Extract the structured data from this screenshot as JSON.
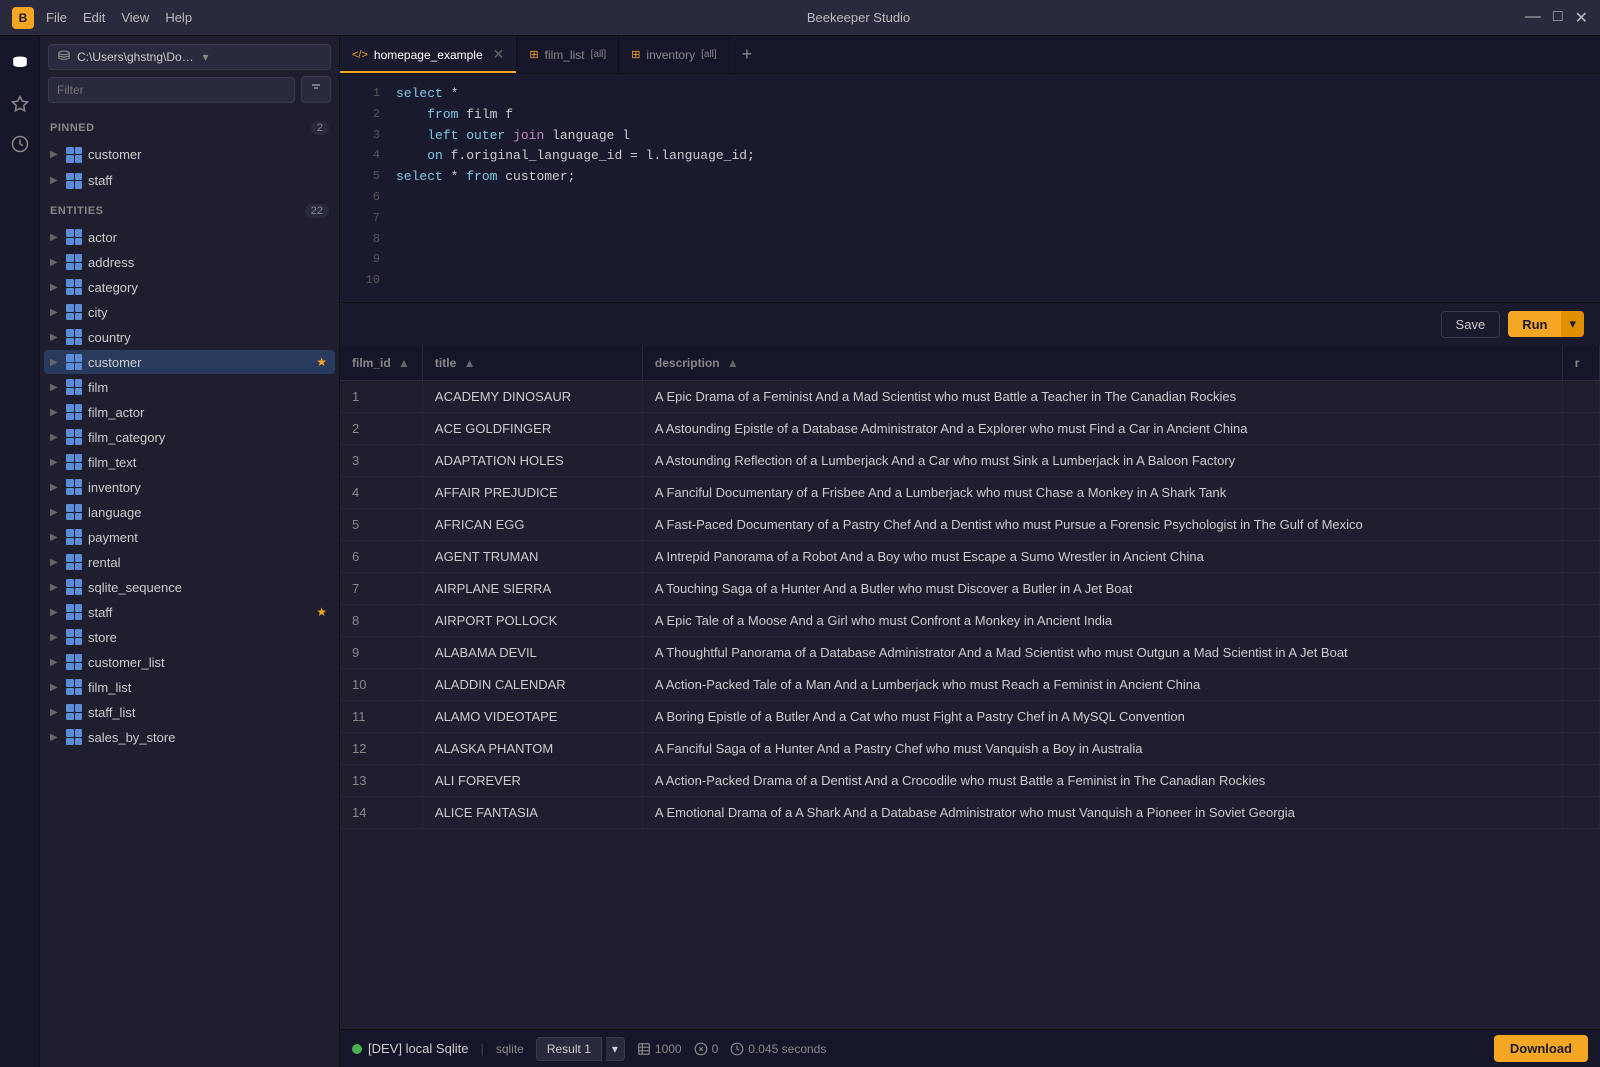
{
  "app": {
    "title": "Beekeeper Studio",
    "icon": "B"
  },
  "titlebar": {
    "menus": [
      "File",
      "Edit",
      "View",
      "Help"
    ],
    "min": "—",
    "max": "□",
    "close": "✕"
  },
  "sidebar": {
    "db_path": "C:\\Users\\ghstng\\Downloads",
    "filter_placeholder": "Filter",
    "pinned": {
      "label": "PINNED",
      "count": 2,
      "items": [
        {
          "name": "customer",
          "pinned": false,
          "removable": true
        },
        {
          "name": "staff",
          "pinned": false,
          "removable": true
        }
      ]
    },
    "entities": {
      "label": "ENTITIES",
      "count": 22,
      "items": [
        "actor",
        "address",
        "category",
        "city",
        "country",
        "customer",
        "film",
        "film_actor",
        "film_category",
        "film_text",
        "inventory",
        "language",
        "payment",
        "rental",
        "sqlite_sequence",
        "staff",
        "store",
        "customer_list",
        "film_list",
        "staff_list",
        "sales_by_store"
      ],
      "starred": [
        "customer",
        "staff"
      ]
    }
  },
  "tabs": [
    {
      "label": "homepage_example",
      "type": "query",
      "active": true,
      "closable": true
    },
    {
      "label": "film_list",
      "badge": "[all]",
      "type": "table",
      "active": false,
      "closable": false
    },
    {
      "label": "inventory",
      "badge": "[all]",
      "type": "table",
      "active": false,
      "closable": false
    }
  ],
  "editor": {
    "lines": [
      {
        "num": 1,
        "tokens": [
          {
            "t": "kw",
            "v": "select"
          },
          {
            "t": "op",
            "v": " *"
          }
        ]
      },
      {
        "num": 2,
        "tokens": [
          {
            "t": "kw",
            "v": "  from"
          },
          {
            "t": "op",
            "v": " film f"
          }
        ]
      },
      {
        "num": 3,
        "tokens": [
          {
            "t": "kw",
            "v": "  left outer"
          },
          {
            "t": "kw2",
            "v": " join"
          },
          {
            "t": "op",
            "v": " language l"
          }
        ]
      },
      {
        "num": 4,
        "tokens": [
          {
            "t": "kw",
            "v": "  on"
          },
          {
            "t": "op",
            "v": " f.original_language_id = l.language_id;"
          }
        ]
      },
      {
        "num": 5,
        "tokens": [
          {
            "t": "kw",
            "v": "select"
          },
          {
            "t": "op",
            "v": " * "
          },
          {
            "t": "kw",
            "v": "from"
          },
          {
            "t": "op",
            "v": " customer;"
          }
        ]
      },
      {
        "num": 6,
        "tokens": []
      },
      {
        "num": 7,
        "tokens": []
      },
      {
        "num": 8,
        "tokens": []
      },
      {
        "num": 9,
        "tokens": []
      },
      {
        "num": 10,
        "tokens": []
      }
    ]
  },
  "toolbar": {
    "save_label": "Save",
    "run_label": "Run"
  },
  "results": {
    "columns": [
      "film_id",
      "title",
      "description",
      "r"
    ],
    "rows": [
      {
        "id": 1,
        "title": "ACADEMY DINOSAUR",
        "description": "A Epic Drama of a Feminist And a Mad Scientist who must Battle a Teacher in The Canadian Rockies"
      },
      {
        "id": 2,
        "title": "ACE GOLDFINGER",
        "description": "A Astounding Epistle of a Database Administrator And a Explorer who must Find a Car in Ancient China"
      },
      {
        "id": 3,
        "title": "ADAPTATION HOLES",
        "description": "A Astounding Reflection of a Lumberjack And a Car who must Sink a Lumberjack in A Baloon Factory"
      },
      {
        "id": 4,
        "title": "AFFAIR PREJUDICE",
        "description": "A Fanciful Documentary of a Frisbee And a Lumberjack who must Chase a Monkey in A Shark Tank"
      },
      {
        "id": 5,
        "title": "AFRICAN EGG",
        "description": "A Fast-Paced Documentary of a Pastry Chef And a Dentist who must Pursue a Forensic Psychologist in The Gulf of Mexico"
      },
      {
        "id": 6,
        "title": "AGENT TRUMAN",
        "description": "A Intrepid Panorama of a Robot And a Boy who must Escape a Sumo Wrestler in Ancient China"
      },
      {
        "id": 7,
        "title": "AIRPLANE SIERRA",
        "description": "A Touching Saga of a Hunter And a Butler who must Discover a Butler in A Jet Boat"
      },
      {
        "id": 8,
        "title": "AIRPORT POLLOCK",
        "description": "A Epic Tale of a Moose And a Girl who must Confront a Monkey in Ancient India"
      },
      {
        "id": 9,
        "title": "ALABAMA DEVIL",
        "description": "A Thoughtful Panorama of a Database Administrator And a Mad Scientist who must Outgun a Mad Scientist in A Jet Boat"
      },
      {
        "id": 10,
        "title": "ALADDIN CALENDAR",
        "description": "A Action-Packed Tale of a Man And a Lumberjack who must Reach a Feminist in Ancient China"
      },
      {
        "id": 11,
        "title": "ALAMO VIDEOTAPE",
        "description": "A Boring Epistle of a Butler And a Cat who must Fight a Pastry Chef in A MySQL Convention"
      },
      {
        "id": 12,
        "title": "ALASKA PHANTOM",
        "description": "A Fanciful Saga of a Hunter And a Pastry Chef who must Vanquish a Boy in Australia"
      },
      {
        "id": 13,
        "title": "ALI FOREVER",
        "description": "A Action-Packed Drama of a Dentist And a Crocodile who must Battle a Feminist in The Canadian Rockies"
      },
      {
        "id": 14,
        "title": "ALICE FANTASIA",
        "description": "A Emotional Drama of a A Shark And a Database Administrator who must Vanquish a Pioneer in Soviet Georgia"
      }
    ]
  },
  "statusbar": {
    "db_label": "[DEV] local Sqlite",
    "db_type": "sqlite",
    "result_tab": "Result 1",
    "row_count": 1000,
    "error_count": 0,
    "query_time": "0.045 seconds",
    "download_label": "Download"
  }
}
